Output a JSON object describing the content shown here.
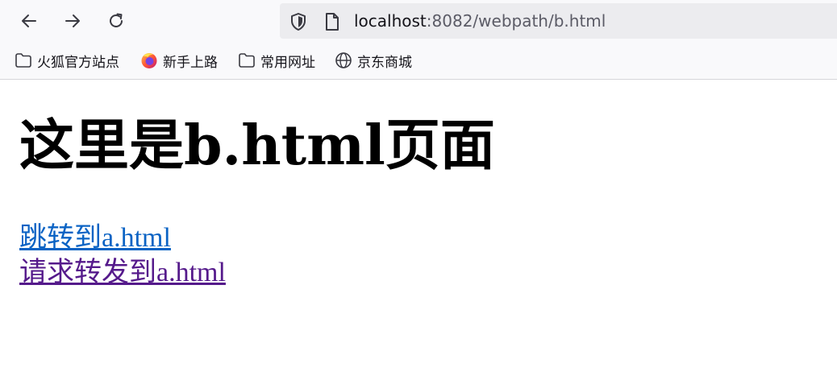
{
  "browser": {
    "url_host": "localhost",
    "url_rest": ":8082/webpath/b.html",
    "bookmarks": [
      {
        "label": "火狐官方站点",
        "icon": "folder-icon"
      },
      {
        "label": "新手上路",
        "icon": "firefox-icon"
      },
      {
        "label": "常用网址",
        "icon": "folder-icon"
      },
      {
        "label": "京东商城",
        "icon": "globe-icon"
      }
    ]
  },
  "page": {
    "title": "这里是b.html页面",
    "links": [
      {
        "label": "跳转到a.html",
        "color": "#0b63c4"
      },
      {
        "label": "请求转发到a.html",
        "color": "#551a8b"
      }
    ]
  },
  "colors": {
    "toolbar_bg": "#f9f9fb",
    "urlbar_bg": "#ececef",
    "link": "#0b63c4",
    "visited_link": "#551a8b"
  }
}
